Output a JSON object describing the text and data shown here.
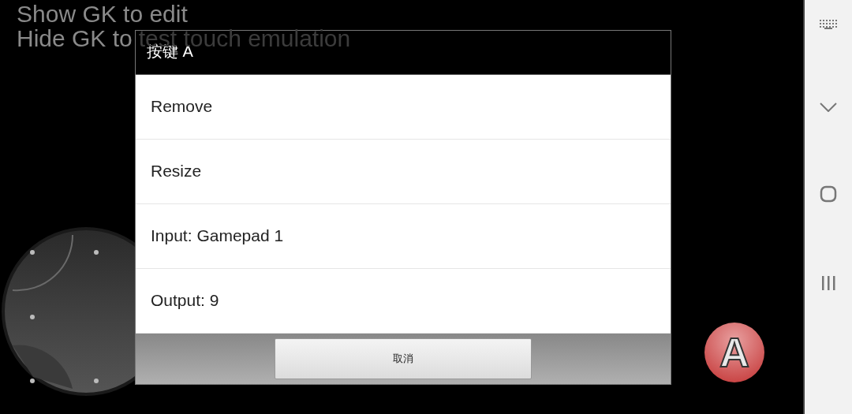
{
  "hints": [
    {
      "text": "Show GK to edit"
    },
    {
      "text": "Hide GK to",
      "covered_text": "test touch emulation"
    }
  ],
  "gamepad_button": {
    "label": "A"
  },
  "dialog": {
    "title": "按键 A",
    "items": [
      {
        "label": "Remove"
      },
      {
        "label": "Resize"
      },
      {
        "label": "Input: Gamepad 1"
      },
      {
        "label": "Output: 9"
      }
    ],
    "buttons": [
      "取消"
    ]
  }
}
